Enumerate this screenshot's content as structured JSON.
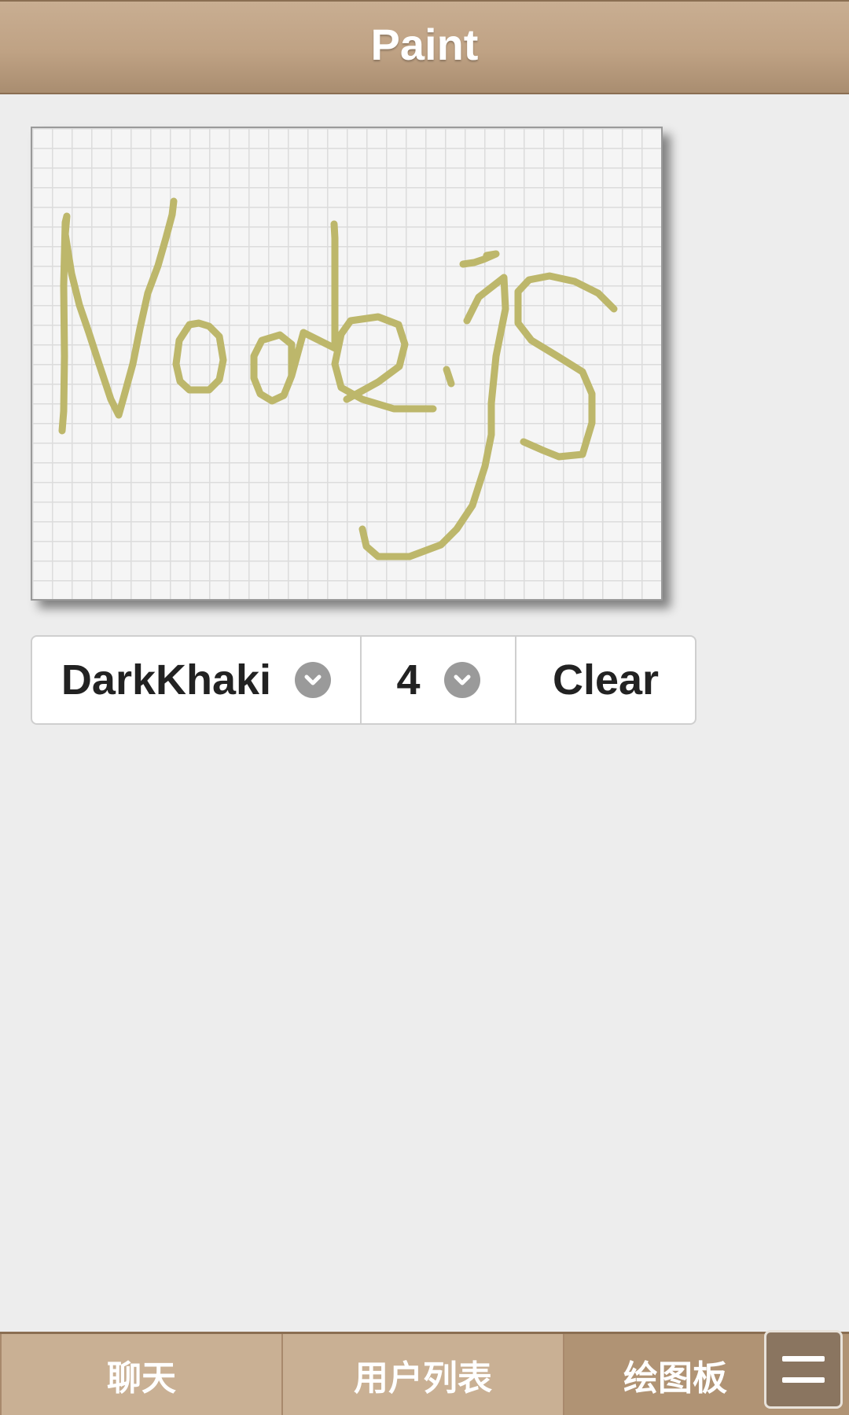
{
  "header": {
    "title": "Paint"
  },
  "controls": {
    "color": {
      "selected": "DarkKhaki",
      "value_hex": "#bdb76b"
    },
    "size": {
      "selected": "4"
    },
    "clear_label": "Clear"
  },
  "canvas": {
    "stroke_color": "#bdb76b",
    "grid_color": "#dcdcdc",
    "background": "#f5f5f5"
  },
  "tabs": [
    {
      "label": "聊天",
      "active": false
    },
    {
      "label": "用户列表",
      "active": false
    },
    {
      "label": "绘图板",
      "active": true
    }
  ],
  "colors": {
    "header": "#bfa284",
    "tabbar": "#c9b094",
    "accent_dark": "#8a6e52"
  },
  "icons": {
    "dropdown": "chevron-down-icon",
    "menu": "menu-icon"
  }
}
